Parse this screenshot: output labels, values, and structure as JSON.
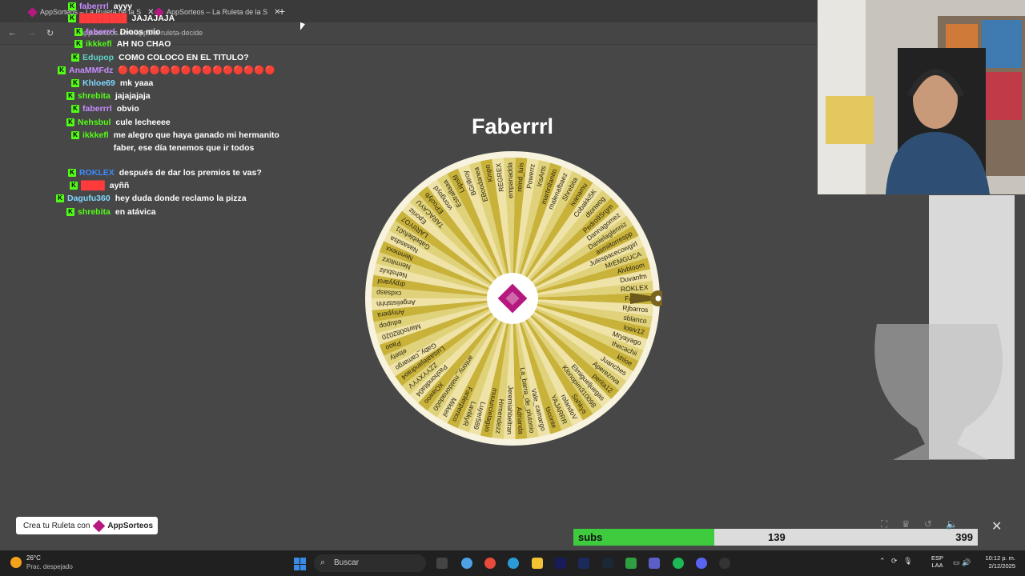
{
  "browser": {
    "tabs": [
      {
        "label": "AppSorteos – La Ruleta de la S"
      },
      {
        "label": "AppSorteos – La Ruleta de la S"
      }
    ],
    "url": "app.sorteos.com/apps/la-ruleta-decide",
    "new_tab": "+"
  },
  "chat": [
    {
      "user": "faberrrl",
      "color": "#c88cff",
      "text": "ayyy"
    },
    {
      "user": "████████",
      "color": "#ff3b3b",
      "text": "JAJAJAJA"
    },
    {
      "user": "faberrrl",
      "color": "#c88cff",
      "text": "Dioos mio"
    },
    {
      "user": "ikkkefl",
      "color": "#53fc18",
      "text": "AH NO CHAO"
    },
    {
      "user": "Edupop",
      "color": "#5fd3c8",
      "text": "COMO COLOCO EN EL TITULO?"
    },
    {
      "user": "AnaMMFdz",
      "color": "#c88cff",
      "text": "🔴🔴🔴🔴🔴🔴🔴🔴🔴🔴🔴🔴🔴🔴🔴"
    },
    {
      "user": "Khloe69",
      "color": "#7fd8ff",
      "text": "mk yaaa"
    },
    {
      "user": "shrebita",
      "color": "#53fc18",
      "text": "jajajajaja"
    },
    {
      "user": "faberrrl",
      "color": "#c88cff",
      "text": "obvio"
    },
    {
      "user": "Nehsbul",
      "color": "#53fc18",
      "text": "cule lecheeee"
    },
    {
      "user": "ikkkefl",
      "color": "#53fc18",
      "text": "me alegro que haya ganado mi hermanito faber, ese día tenemos que ir todos"
    },
    {
      "user": "ROKLEX",
      "color": "#3b8bff",
      "text": "después de dar los premios te vas?"
    },
    {
      "user": "████",
      "color": "#ff3b3b",
      "text": "ayññ"
    },
    {
      "user": "Dagufu360",
      "color": "#7fd8ff",
      "text": "hey duda donde reclamo la pizza"
    },
    {
      "user": "shrebita",
      "color": "#53fc18",
      "text": "en atávica"
    }
  ],
  "wheel": {
    "winner": "Faberrrl",
    "names": [
      "Faberrrl",
      "Rjbarros",
      "sblanco",
      "losiv12",
      "Mryayago",
      "thecachii",
      "khloe",
      "Juanches",
      "Apereznva",
      "perita12",
      "Elmigueljuegas",
      "Klonopim310098",
      "Sahkys",
      "rolandoV",
      "YAJARRR",
      "tsconte",
      "Vale_camargo",
      "La_barra_de_plutonio",
      "Adrianda",
      "Jeremiahbeltran",
      "Hrmendezz",
      "muuurcielaguo",
      "Luyer589",
      "LavlikyR",
      "Fanlerperico",
      "Mikkeil",
      "antony_maldonado00",
      "XOawoo",
      "Pashondita04",
      "ZZYYXYYV",
      "Luisaalejandrao4",
      "Gaby_camargo",
      "elsety",
      "Paoo",
      "Marto082020",
      "edupop",
      "Amypera",
      "Angelistshhh",
      "cxdsasp",
      "drpyyarol",
      "Nehsbulz",
      "Nermitorz",
      "Nenmexx",
      "Nasasdsa",
      "Gabeblefo01",
      "LARIIYO7",
      "Eporiiz",
      "TARACAYU",
      "EPoolyb",
      "vrongoyd",
      "Estrallaaa",
      "Liipsfil",
      "BGrillroy",
      "EBoodanea",
      "Kinpo",
      "REGREX",
      "empanadda",
      "reind_luis",
      "Powerrz",
      "IrisArts",
      "martinllanito",
      "malenafbaez",
      "Shrebita",
      "ivanamu",
      "Cobakki5K",
      "dtonwog",
      "Pedro9Srgm",
      "Dannagomez",
      "Danielaglenniz",
      "asmiitorrespp",
      "Julespacecowgirl",
      "MrEMGUCA",
      "Alvbloom",
      "Duvanfm",
      "ROKLEX"
    ],
    "colors": [
      "#c8b23a",
      "#efe3a8",
      "#e0d27a"
    ]
  },
  "promo": {
    "prefix": "Crea tu Ruleta con",
    "brand": "AppSorteos"
  },
  "subs": {
    "label": "subs",
    "count": "139",
    "goal": "399",
    "progress": 0.348
  },
  "taskbar": {
    "temp": "26°C",
    "weather": "Prac. despejado",
    "search": "Buscar",
    "lang1": "ESP",
    "lang2": "LAA",
    "time": "10:12 p. m.",
    "date": "2/12/2025"
  }
}
